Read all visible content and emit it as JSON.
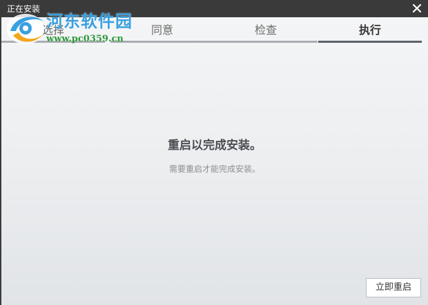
{
  "window": {
    "title": "正在安装"
  },
  "watermark": {
    "site_name": "河东软件园",
    "site_url": "www.pc0359.cn"
  },
  "steps": [
    {
      "label": "选择",
      "active": false
    },
    {
      "label": "同意",
      "active": false
    },
    {
      "label": "检查",
      "active": false
    },
    {
      "label": "执行",
      "active": true
    }
  ],
  "message": {
    "main": "重启以完成安装。",
    "sub": "需要重启才能完成安装。"
  },
  "buttons": {
    "restart_now": "立即重启"
  },
  "colors": {
    "titlebar": "#3a3a3a",
    "active_step_bar": "#5b6168",
    "inactive_step_bar": "#a9adb1",
    "watermark_blue": "#3aa0e0",
    "watermark_green": "#2e9a3c"
  },
  "icons": {
    "close": "close-icon",
    "logo": "watermark-logo-icon"
  }
}
